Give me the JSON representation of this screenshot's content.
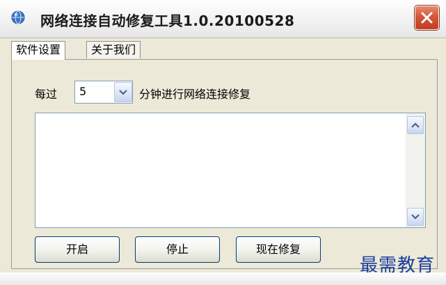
{
  "window": {
    "title": "网络连接自动修复工具1.0.20100528",
    "app_icon": "app-globe-icon",
    "close_icon": "close-icon"
  },
  "tabs": [
    {
      "label": "软件设置",
      "active": true
    },
    {
      "label": "关于我们",
      "active": false
    }
  ],
  "settings": {
    "prefix_label": "每过",
    "interval_value": "5",
    "suffix_label": "分钟进行网络连接修复"
  },
  "log": {
    "content": "",
    "scroll_up_icon": "chevron-up-icon",
    "scroll_down_icon": "chevron-down-icon"
  },
  "buttons": {
    "start": "开启",
    "stop": "停止",
    "repair_now": "现在修复"
  },
  "watermark": "最需教育",
  "colors": {
    "close_button": "#d4573a",
    "watermark": "#1a3d9c",
    "background": "#ece9d8"
  }
}
